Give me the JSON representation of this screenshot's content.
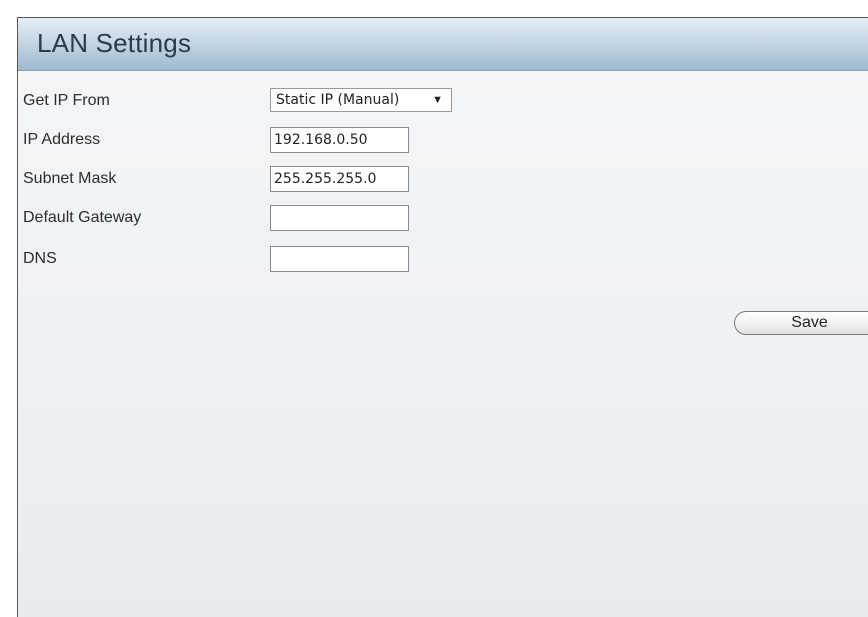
{
  "panel": {
    "title": "LAN Settings"
  },
  "form": {
    "get_ip_from": {
      "label": "Get IP From",
      "value": "Static IP (Manual)"
    },
    "ip_address": {
      "label": "IP Address",
      "value": "192.168.0.50"
    },
    "subnet_mask": {
      "label": "Subnet Mask",
      "value": "255.255.255.0"
    },
    "default_gateway": {
      "label": "Default Gateway",
      "value": ""
    },
    "dns": {
      "label": "DNS",
      "value": ""
    }
  },
  "actions": {
    "save_label": "Save"
  },
  "icons": {
    "dropdown_arrow": "chevron-down-icon"
  }
}
